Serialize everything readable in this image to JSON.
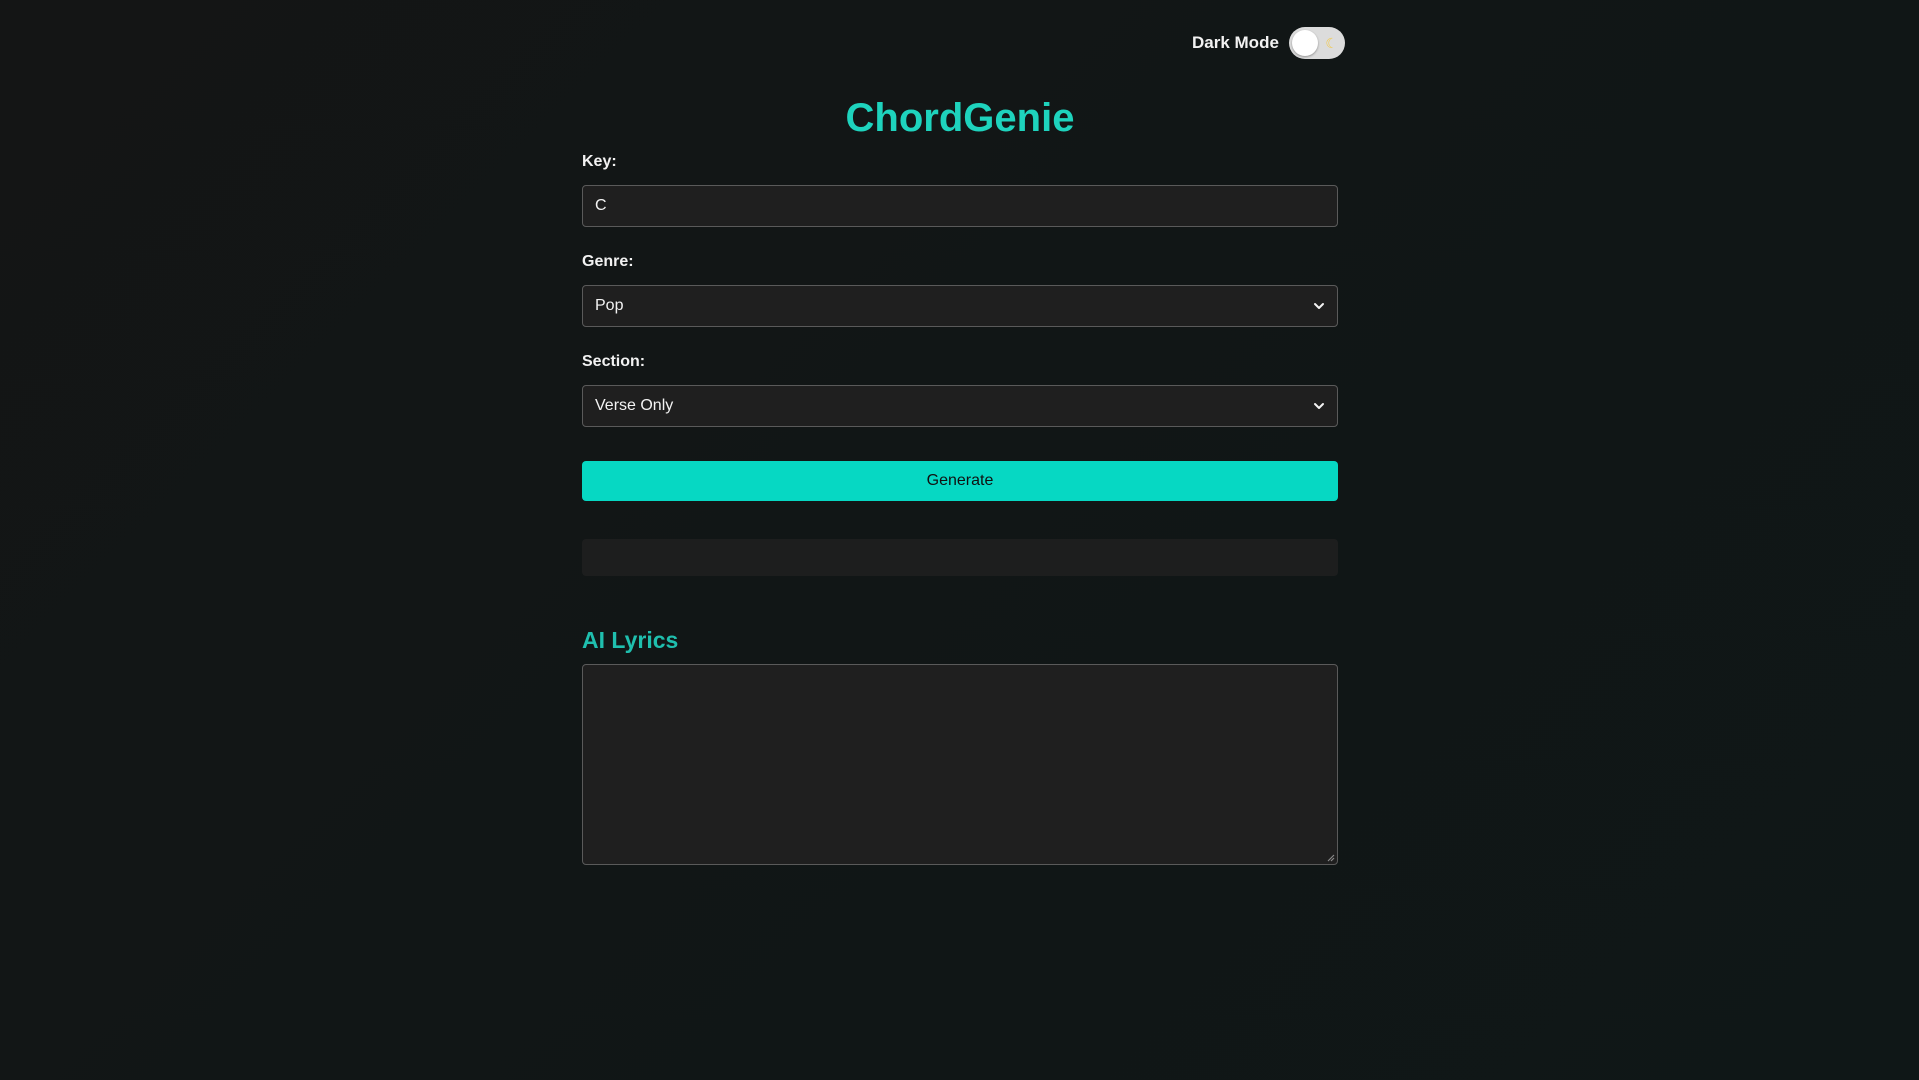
{
  "theme_toggle": {
    "label": "Dark Mode",
    "state": "off",
    "icon": "moon-icon"
  },
  "app": {
    "title": "ChordGenie"
  },
  "form": {
    "key": {
      "label": "Key:",
      "value": "C"
    },
    "genre": {
      "label": "Genre:",
      "selected": "Pop"
    },
    "section": {
      "label": "Section:",
      "selected": "Verse Only"
    },
    "generate_label": "Generate"
  },
  "output": {
    "chords_text": ""
  },
  "lyrics": {
    "heading": "AI Lyrics",
    "text": ""
  },
  "colors": {
    "accent": "#06d8c3",
    "title": "#1ed3bd",
    "background": "#131616",
    "field_bg": "#1f1f1f"
  }
}
